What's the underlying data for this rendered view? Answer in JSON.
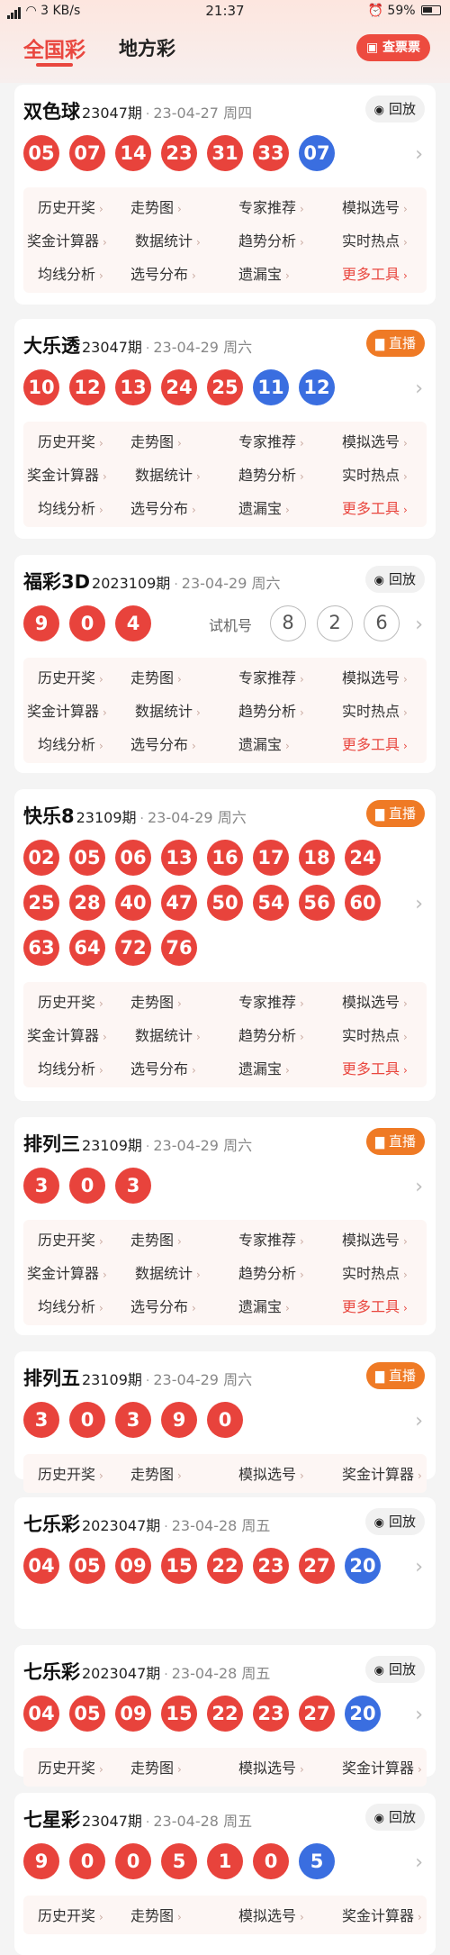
{
  "status": {
    "network": "3 KB/s",
    "time": "21:37",
    "battery": "59%"
  },
  "tabs": [
    "全国彩",
    "地方彩"
  ],
  "check_button": "查票票",
  "colors": {
    "accent": "#e9473f",
    "red_ball": "#e8433c",
    "blue_ball": "#3a6ee0",
    "live": "#ef7a25"
  },
  "lotteries": [
    {
      "name": "双色球",
      "issue": "23047期",
      "date": "23-04-27 周四",
      "action": {
        "type": "replay",
        "label": "回放"
      },
      "balls": [
        [
          "05",
          "red"
        ],
        [
          "07",
          "red"
        ],
        [
          "14",
          "red"
        ],
        [
          "23",
          "red"
        ],
        [
          "31",
          "red"
        ],
        [
          "33",
          "red"
        ],
        [
          "07",
          "blue"
        ]
      ],
      "tools": [
        "历史开奖",
        "走势图",
        "专家推荐",
        "模拟选号",
        "奖金计算器",
        "数据统计",
        "趋势分析",
        "实时热点",
        "均线分析",
        "选号分布",
        "遗漏宝",
        "更多工具"
      ]
    },
    {
      "name": "大乐透",
      "issue": "23047期",
      "date": "23-04-29 周六",
      "action": {
        "type": "live",
        "label": "直播"
      },
      "balls": [
        [
          "10",
          "red"
        ],
        [
          "12",
          "red"
        ],
        [
          "13",
          "red"
        ],
        [
          "24",
          "red"
        ],
        [
          "25",
          "red"
        ],
        [
          "11",
          "blue"
        ],
        [
          "12",
          "blue"
        ]
      ],
      "tools": [
        "历史开奖",
        "走势图",
        "专家推荐",
        "模拟选号",
        "奖金计算器",
        "数据统计",
        "趋势分析",
        "实时热点",
        "均线分析",
        "选号分布",
        "遗漏宝",
        "更多工具"
      ]
    },
    {
      "name": "福彩3D",
      "issue": "2023109期",
      "date": "23-04-29 周六",
      "action": {
        "type": "replay",
        "label": "回放"
      },
      "balls": [
        [
          "9",
          "red"
        ],
        [
          "0",
          "red"
        ],
        [
          "4",
          "red"
        ]
      ],
      "trial_label": "试机号",
      "trial_numbers": [
        "8",
        "2",
        "6"
      ],
      "tools": [
        "历史开奖",
        "走势图",
        "专家推荐",
        "模拟选号",
        "奖金计算器",
        "数据统计",
        "趋势分析",
        "实时热点",
        "均线分析",
        "选号分布",
        "遗漏宝",
        "更多工具"
      ]
    },
    {
      "name": "快乐8",
      "issue": "23109期",
      "date": "23-04-29 周六",
      "action": {
        "type": "live",
        "label": "直播"
      },
      "balls": [
        [
          "02",
          "red"
        ],
        [
          "05",
          "red"
        ],
        [
          "06",
          "red"
        ],
        [
          "13",
          "red"
        ],
        [
          "16",
          "red"
        ],
        [
          "17",
          "red"
        ],
        [
          "18",
          "red"
        ],
        [
          "24",
          "red"
        ],
        [
          "25",
          "red"
        ],
        [
          "28",
          "red"
        ],
        [
          "40",
          "red"
        ],
        [
          "47",
          "red"
        ],
        [
          "50",
          "red"
        ],
        [
          "54",
          "red"
        ],
        [
          "56",
          "red"
        ],
        [
          "60",
          "red"
        ],
        [
          "63",
          "red"
        ],
        [
          "64",
          "red"
        ],
        [
          "72",
          "red"
        ],
        [
          "76",
          "red"
        ]
      ],
      "tools": [
        "历史开奖",
        "走势图",
        "专家推荐",
        "模拟选号",
        "奖金计算器",
        "数据统计",
        "趋势分析",
        "实时热点",
        "均线分析",
        "选号分布",
        "遗漏宝",
        "更多工具"
      ]
    },
    {
      "name": "排列三",
      "issue": "23109期",
      "date": "23-04-29 周六",
      "action": {
        "type": "live",
        "label": "直播"
      },
      "balls": [
        [
          "3",
          "red"
        ],
        [
          "0",
          "red"
        ],
        [
          "3",
          "red"
        ]
      ],
      "tools": [
        "历史开奖",
        "走势图",
        "专家推荐",
        "模拟选号",
        "奖金计算器",
        "数据统计",
        "趋势分析",
        "实时热点",
        "均线分析",
        "选号分布",
        "遗漏宝",
        "更多工具"
      ]
    },
    {
      "name": "排列五",
      "issue": "23109期",
      "date": "23-04-29 周六",
      "action": {
        "type": "live",
        "label": "直播"
      },
      "balls": [
        [
          "3",
          "red"
        ],
        [
          "0",
          "red"
        ],
        [
          "3",
          "red"
        ],
        [
          "9",
          "red"
        ],
        [
          "0",
          "red"
        ]
      ],
      "tools": [
        "历史开奖",
        "走势图",
        "模拟选号",
        "奖金计算器"
      ]
    },
    {
      "name": "七乐彩",
      "issue": "2023047期",
      "date": "23-04-28 周五",
      "action": {
        "type": "replay",
        "label": "回放"
      },
      "balls": [
        [
          "04",
          "red"
        ],
        [
          "05",
          "red"
        ],
        [
          "09",
          "red"
        ],
        [
          "15",
          "red"
        ],
        [
          "22",
          "red"
        ],
        [
          "23",
          "red"
        ],
        [
          "27",
          "red"
        ],
        [
          "20",
          "blue"
        ]
      ],
      "tools": []
    },
    {
      "name": "七乐彩",
      "issue": "2023047期",
      "date": "23-04-28 周五",
      "action": {
        "type": "replay",
        "label": "回放"
      },
      "balls": [
        [
          "04",
          "red"
        ],
        [
          "05",
          "red"
        ],
        [
          "09",
          "red"
        ],
        [
          "15",
          "red"
        ],
        [
          "22",
          "red"
        ],
        [
          "23",
          "red"
        ],
        [
          "27",
          "red"
        ],
        [
          "20",
          "blue"
        ]
      ],
      "tools": [
        "历史开奖",
        "走势图",
        "模拟选号",
        "奖金计算器"
      ]
    },
    {
      "name": "七星彩",
      "issue": "23047期",
      "date": "23-04-28 周五",
      "action": {
        "type": "replay",
        "label": "回放"
      },
      "balls": [
        [
          "9",
          "red"
        ],
        [
          "0",
          "red"
        ],
        [
          "0",
          "red"
        ],
        [
          "5",
          "red"
        ],
        [
          "1",
          "red"
        ],
        [
          "0",
          "red"
        ],
        [
          "5",
          "blue"
        ]
      ],
      "tools": [
        "历史开奖",
        "走势图",
        "模拟选号",
        "奖金计算器"
      ]
    }
  ]
}
